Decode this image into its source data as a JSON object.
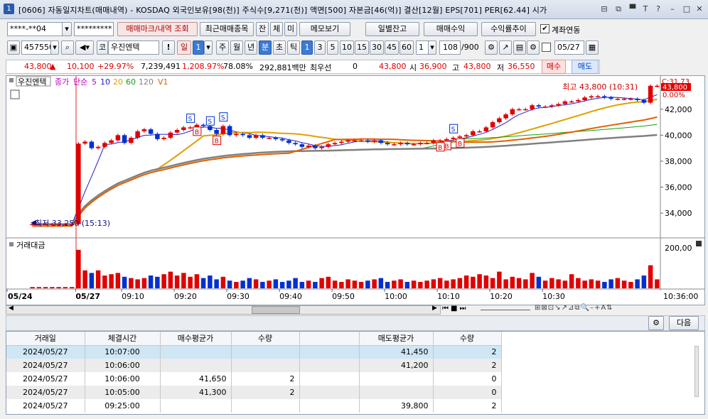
{
  "window": {
    "title": "[0606] 자동일지차트(매매내역) - KOSDAQ 외국인보유[98(천)] 주식수[9,271(천)] 액면[500] 자본금[46(억)] 결산[12월] EPS[701] PER[62.44] 시가",
    "icon": "1",
    "controls": [
      "⊟",
      "⧉",
      "▀",
      "T",
      "?",
      "–",
      "□",
      "✕"
    ]
  },
  "toolbar1": {
    "account": "****-**04",
    "password": "*********",
    "buttons": [
      "매매마크/내역 조회",
      "최근매매종목",
      "잔",
      "체",
      "미",
      "메모보기",
      "일별잔고",
      "매매수익",
      "수익률추이"
    ],
    "link_label": "계좌연동",
    "link_checked": true
  },
  "toolbar2": {
    "code": "457550",
    "stock_name": "우진엔텍",
    "market_label": "코",
    "period_buttons": [
      "일",
      "주",
      "월",
      "년",
      "분",
      "초",
      "틱"
    ],
    "period_num": "1",
    "minute_buttons": [
      "1",
      "3",
      "5",
      "10",
      "15",
      "30",
      "45",
      "60"
    ],
    "interval": "1",
    "count": "108",
    "count_max": "/900",
    "date": "05/27"
  },
  "quote": {
    "price": "43,800",
    "arrow": "▲",
    "change": "10,100",
    "rate": "+29.97%",
    "volume": "7,239,491",
    "vol_rate": "1,208.97%",
    "turnover": "78.08%",
    "amount": "292,881백만",
    "hoga_label": "최우선",
    "hoga_val": "0",
    "ask": "43,800",
    "open_label": "시",
    "open": "36,900",
    "high_label": "고",
    "high": "43,800",
    "low_label": "저",
    "low": "36,550",
    "buy_label": "매수",
    "sell_label": "매도"
  },
  "chart_data": {
    "type": "candlestick",
    "stock": "우진엔텍",
    "legend": [
      {
        "label": "종가",
        "color": "#c000c0"
      },
      {
        "label": "단순",
        "color": "#c000c0"
      },
      {
        "label": "5",
        "color": "#c000c0"
      },
      {
        "label": "10",
        "color": "#2020d0"
      },
      {
        "label": "20",
        "color": "#e0a000"
      },
      {
        "label": "60",
        "color": "#10a010"
      },
      {
        "label": "120",
        "color": "#808080"
      },
      {
        "label": "V1",
        "color": "#e06000"
      }
    ],
    "y_ticks": [
      34000,
      36000,
      38000,
      40000,
      42000
    ],
    "y_tick_labels": [
      "34,000",
      "36,000",
      "38,000",
      "40,000",
      "42,000"
    ],
    "ylim": [
      32200,
      43900
    ],
    "x_ticks": [
      "05/24",
      "05/27",
      "09:10",
      "09:20",
      "09:30",
      "09:40",
      "09:50",
      "10:00",
      "10:10",
      "10:20",
      "10:30"
    ],
    "x_right_label": "10:36:00",
    "top_labels": {
      "c_value": "C:31.73",
      "price_tag": "43,800",
      "pct_tag": "0.00%"
    },
    "annotations": {
      "high": "최고 43,800 (10:31)",
      "low": "최저 33,250 (15:13)"
    },
    "trade_marks": [
      "S",
      "B",
      "B",
      "S",
      "S",
      "S",
      "B",
      "B",
      "B"
    ],
    "volume_panel": {
      "title": "거래대금",
      "tick": "200,00"
    },
    "closes": [
      33150,
      33150,
      33150,
      33150,
      33150,
      33150,
      33150,
      39350,
      39500,
      39000,
      39100,
      39400,
      39600,
      40000,
      39400,
      39800,
      40300,
      40450,
      40100,
      39700,
      39800,
      40200,
      40400,
      40600,
      40600,
      40800,
      40700,
      40400,
      40100,
      40700,
      40000,
      40100,
      40000,
      39800,
      40000,
      39800,
      39800,
      39700,
      39600,
      39400,
      39300,
      39100,
      39200,
      39000,
      39100,
      39300,
      39400,
      39500,
      39600,
      39600,
      39600,
      39500,
      39600,
      39400,
      39300,
      39300,
      39400,
      39300,
      39300,
      39400,
      39400,
      39600,
      39600,
      39700,
      39800,
      39900,
      40000,
      40300,
      40300,
      40600,
      41000,
      41300,
      41600,
      42000,
      42000,
      42000,
      42300,
      42200,
      42200,
      42300,
      42400,
      42600,
      42600,
      42700,
      42900,
      43000,
      43000,
      42900,
      42800,
      42800,
      42800,
      42800,
      42700,
      42500,
      43800,
      43800
    ],
    "volumes": [
      2,
      2,
      2,
      2,
      2,
      2,
      2,
      60,
      28,
      24,
      28,
      20,
      22,
      24,
      18,
      16,
      14,
      16,
      20,
      18,
      22,
      26,
      20,
      24,
      18,
      22,
      16,
      20,
      14,
      18,
      12,
      10,
      12,
      16,
      14,
      10,
      12,
      14,
      10,
      12,
      16,
      10,
      12,
      10,
      16,
      18,
      12,
      10,
      14,
      12,
      10,
      12,
      14,
      16,
      10,
      12,
      14,
      10,
      12,
      10,
      12,
      14,
      16,
      12,
      14,
      16,
      20,
      18,
      22,
      20,
      16,
      26,
      14,
      18,
      16,
      14,
      24,
      18,
      12,
      16,
      14,
      12,
      22,
      16,
      12,
      14,
      12,
      10,
      14,
      16,
      12,
      10,
      14,
      20,
      36,
      14
    ]
  },
  "scroll": {
    "tools": [
      "⊞",
      "⊠",
      "⊡",
      "↘",
      "↗",
      "⊿",
      "⧉",
      "🔍",
      "–",
      "+",
      "A",
      "⇅"
    ]
  },
  "grid": {
    "next_label": "다음",
    "headers": [
      "거래일",
      "체결시간",
      "매수평균가",
      "수량",
      "",
      "매도평균가",
      "수량"
    ],
    "rows": [
      [
        "2024/05/27",
        "10:07:00",
        "",
        "",
        "",
        "41,450",
        "2"
      ],
      [
        "2024/05/27",
        "10:06:00",
        "",
        "",
        "",
        "41,200",
        "2"
      ],
      [
        "2024/05/27",
        "10:06:00",
        "41,650",
        "2",
        "",
        "",
        "0"
      ],
      [
        "2024/05/27",
        "10:05:00",
        "41,300",
        "2",
        "",
        "",
        "0"
      ],
      [
        "2024/05/27",
        "09:25:00",
        "",
        "",
        "",
        "39,800",
        "2"
      ]
    ]
  }
}
